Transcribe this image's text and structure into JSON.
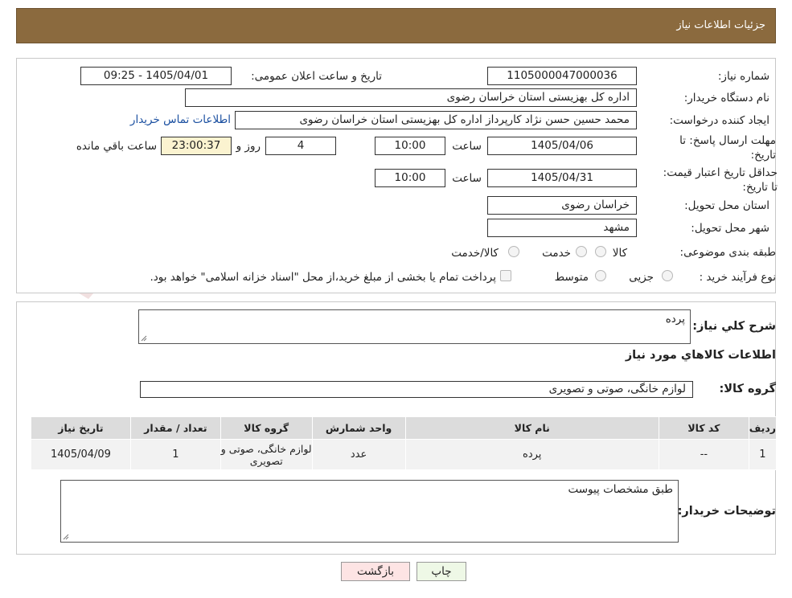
{
  "header": {
    "title": "جزئیات اطلاعات نیاز"
  },
  "form": {
    "need_number_label": "شماره نیاز:",
    "need_number": "1105000047000036",
    "announce_label": "تاریخ و ساعت اعلان عمومی:",
    "announce_value": "1405/04/01 - 09:25",
    "buyer_org_label": "نام دستگاه خریدار:",
    "buyer_org": "اداره کل بهزیستی استان خراسان رضوی",
    "requester_label": "ایجاد کننده درخواست:",
    "requester": "محمد حسین حسن نژاد کارپرداز اداره کل بهزیستی استان خراسان رضوی",
    "contact_link": "اطلاعات تماس خریدار",
    "deadline_label": "مهلت ارسال پاسخ: تا تاریخ:",
    "deadline_date": "1405/04/06",
    "hour_label": "ساعت",
    "deadline_time": "10:00",
    "days_value": "4",
    "days_label": "روز و",
    "remaining_time": "23:00:37",
    "remaining_label": "ساعت باقي مانده",
    "validity_label": "حداقل تاریخ اعتبار قیمت: تا تاریخ:",
    "validity_date": "1405/04/31",
    "validity_hour_label": "ساعت",
    "validity_time": "10:00",
    "province_label": "استان محل تحویل:",
    "province": "خراسان رضوی",
    "city_label": "شهر محل تحویل:",
    "city": "مشهد",
    "category_label": "طبقه بندی موضوعی:",
    "category_options": [
      "کالا",
      "خدمت",
      "کالا/خدمت"
    ],
    "process_label": "نوع فرآیند خرید :",
    "process_options": [
      "جزیی",
      "متوسط"
    ],
    "treasury_note": "پرداخت تمام یا بخشی از مبلغ خرید،از محل \"اسناد خزانه اسلامی\" خواهد بود."
  },
  "details": {
    "description_label": "شرح كلي نیاز:",
    "description": "پرده",
    "goods_info_title": "اطلاعات كالاهاي مورد نیاز",
    "goods_group_label": "گروه كالا:",
    "goods_group": "لوازم خانگی، صوتی و تصویری",
    "table": {
      "headers": [
        "ردیف",
        "کد کالا",
        "نام کالا",
        "واحد شمارش",
        "گروه کالا",
        "تعداد / مقدار",
        "تاریخ نیاز"
      ],
      "rows": [
        [
          "1",
          "--",
          "پرده",
          "عدد",
          "لوازم خانگی، صوتی و تصویری",
          "1",
          "1405/04/09"
        ]
      ]
    },
    "buyer_notes_label": "توضیحات خریدار:",
    "buyer_notes": "طبق مشخصات پیوست"
  },
  "buttons": {
    "print": "چاپ",
    "back": "بازگشت"
  },
  "watermark": {
    "text": "AriaTender.neT"
  },
  "colors": {
    "header_bg": "#8b6a3e",
    "link": "#1a4fa0",
    "print_bg": "#eef8e6",
    "back_bg": "#fde4e4"
  }
}
